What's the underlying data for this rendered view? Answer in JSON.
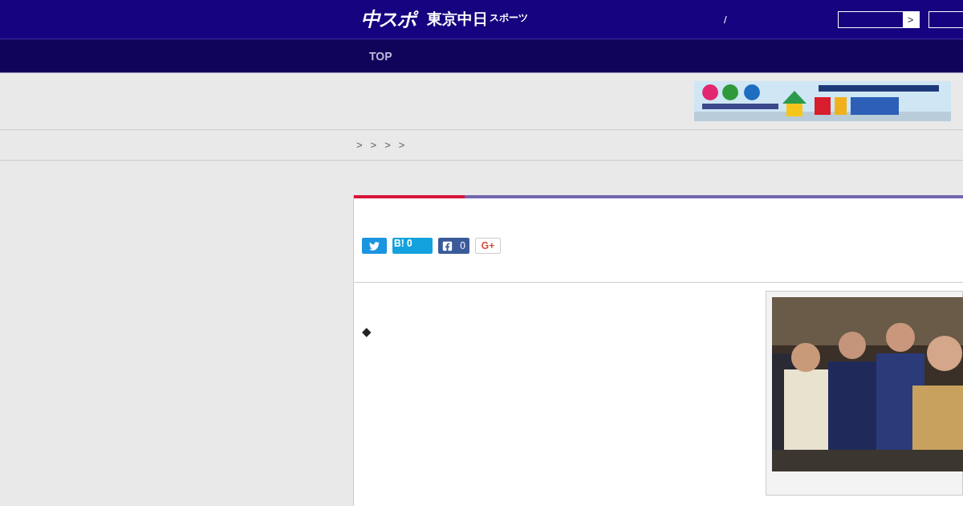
{
  "header": {
    "logo_main": "中スポ",
    "logo_sub": "東京中日",
    "logo_small": "スポーツ",
    "separator": "/",
    "search_button": ">"
  },
  "nav": {
    "items": [
      {
        "label": "TOP",
        "selected": false
      }
    ]
  },
  "breadcrumb": [
    ">",
    ">",
    ">",
    ">"
  ],
  "share": [
    {
      "kind": "twitter"
    },
    {
      "kind": "hatena",
      "mark": "B!",
      "count": "0"
    },
    {
      "kind": "facebook",
      "count": "0"
    },
    {
      "kind": "google",
      "mark": "G+"
    }
  ],
  "article": {
    "bullet": "◆"
  }
}
